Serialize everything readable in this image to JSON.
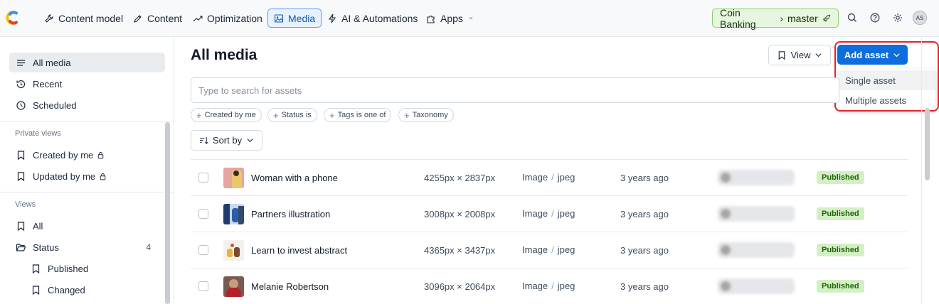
{
  "topbar": {
    "nav": [
      {
        "label": "Content model",
        "icon": "wrench-icon"
      },
      {
        "label": "Content",
        "icon": "pen-icon"
      },
      {
        "label": "Optimization",
        "icon": "trend-icon"
      },
      {
        "label": "Media",
        "icon": "image-icon",
        "active": true
      },
      {
        "label": "AI & Automations",
        "icon": "lightning-icon"
      },
      {
        "label": "Apps",
        "icon": "puzzle-icon"
      }
    ],
    "space": "Coin Banking",
    "environment": "master",
    "avatar_initials": "AS"
  },
  "sidebar": {
    "items": [
      {
        "label": "All media"
      },
      {
        "label": "Recent"
      },
      {
        "label": "Scheduled"
      }
    ],
    "private_views_heading": "Private views",
    "private_views": [
      {
        "label": "Created by me"
      },
      {
        "label": "Updated by me"
      }
    ],
    "views_heading": "Views",
    "views": [
      {
        "label": "All"
      },
      {
        "label": "Status",
        "count": "4"
      },
      {
        "label": "Published"
      },
      {
        "label": "Changed"
      }
    ]
  },
  "main": {
    "title": "All media",
    "view_label": "View",
    "add_asset_label": "Add asset",
    "dropdown": [
      "Single asset",
      "Multiple assets"
    ],
    "search_placeholder": "Type to search for assets",
    "filters": [
      "Created by me",
      "Status is",
      "Tags is one of",
      "Taxonomy"
    ],
    "sort_label": "Sort by",
    "rows": [
      {
        "name": "Woman with a phone",
        "dims": "4255px × 2837px",
        "kind": "Image",
        "format": "jpeg",
        "updated": "3 years ago",
        "status": "Published"
      },
      {
        "name": "Partners illustration",
        "dims": "3008px × 2008px",
        "kind": "Image",
        "format": "jpeg",
        "updated": "3 years ago",
        "status": "Published"
      },
      {
        "name": "Learn to invest abstract",
        "dims": "4365px × 3437px",
        "kind": "Image",
        "format": "jpeg",
        "updated": "3 years ago",
        "status": "Published"
      },
      {
        "name": "Melanie Robertson",
        "dims": "3096px × 2064px",
        "kind": "Image",
        "format": "jpeg",
        "updated": "3 years ago",
        "status": "Published"
      }
    ]
  },
  "colors": {
    "accent": "#0e6ddc",
    "published_bg": "#d3f0c4",
    "highlight_border": "#e0242f"
  }
}
